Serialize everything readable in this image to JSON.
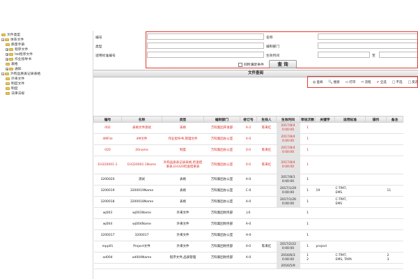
{
  "tree": {
    "root": "文件类型",
    "items": [
      {
        "label": "体系文件",
        "toggle": "−"
      },
      {
        "label": "质量手册",
        "toggle": ""
      },
      {
        "label": "程序文件",
        "toggle": "+"
      },
      {
        "label": "iso程序文件",
        "toggle": "+"
      },
      {
        "label": "作业指导书",
        "toggle": "+"
      },
      {
        "label": "表格",
        "toggle": ""
      },
      {
        "label": "通知",
        "toggle": "+"
      },
      {
        "label": "外购品质表记录表格",
        "toggle": "−"
      },
      {
        "label": "外来文件",
        "toggle": ""
      },
      {
        "label": "制度文件",
        "toggle": ""
      },
      {
        "label": "制度",
        "toggle": ""
      },
      {
        "label": "法律法规",
        "toggle": ""
      }
    ]
  },
  "query": {
    "labels": {
      "number": "编号",
      "name": "名称",
      "type": "类型",
      "dept": "编制部门",
      "standard_no": "适用标准编号",
      "effective_time": "生效时间",
      "to": "至"
    },
    "condition_label": "同时满足条件",
    "query_button": "查 询"
  },
  "section_title": "文件查阅",
  "toolbar": [
    {
      "icon": "view-icon",
      "glyph": "◎",
      "label": "查阅"
    },
    {
      "icon": "search-icon",
      "glyph": "🔍",
      "label": "搜索"
    },
    {
      "icon": "print-icon",
      "glyph": "▭",
      "label": "打印"
    },
    {
      "icon": "flow-icon",
      "glyph": "⇨",
      "label": "流程"
    },
    {
      "icon": "check-all-icon",
      "glyph": "✔",
      "label": "全选"
    },
    {
      "icon": "deselect-icon",
      "glyph": "▢",
      "label": "不选"
    },
    {
      "icon": "invert-icon",
      "glyph": "▢",
      "label": "反选"
    }
  ],
  "table": {
    "columns": [
      "编号",
      "名称",
      "类型",
      "编制部门",
      "修订号",
      "生效人",
      "生效时间",
      "审核次数",
      "关键字",
      "适用标准",
      "操作",
      "备注"
    ],
    "rows": [
      {
        "red": true,
        "cells": [
          "002",
          "表格文件测试",
          "表格",
          "万科集团开发部",
          "A-2",
          "陈来红",
          "2017/8/4\n0:00:00",
          "1",
          "",
          "",
          "",
          ""
        ]
      },
      {
        "red": true,
        "cells": [
          "4MFile",
          "4M文件",
          "作业指导书,管理文件",
          "万科集团办公室",
          "A-0",
          "",
          "2017/8/4\n0:00:00",
          "1",
          "",
          "",
          "",
          ""
        ]
      },
      {
        "red": true,
        "cells": [
          "020",
          "20name",
          "制度",
          "万科集团办公室",
          "0-0",
          "陈来红",
          "2017/8/4\n0:00:00",
          "1",
          "",
          "",
          "",
          ""
        ]
      },
      {
        "red": true,
        "cells": [
          "EH320001-1",
          "EH320001-1Name",
          "外购品质表记录表格,检查结果表,EH320检查结果表",
          "万科集团办公室",
          "0-0",
          "陈来红",
          "2017/8/4\n0:00:00",
          "1",
          "",
          "",
          "",
          ""
        ]
      },
      {
        "red": false,
        "cells": [
          "3200020",
          "测试",
          "表格",
          "万科集团办公室",
          "A-0",
          "",
          "2017/8/1\n0:00:00",
          "1",
          "",
          "",
          "",
          ""
        ]
      },
      {
        "red": false,
        "cells": [
          "3200019",
          "3200019Name",
          "表格",
          "万科集团办公室",
          "C-0",
          "",
          "2017/1/29\n0:00:00",
          "1",
          "19",
          "C-TPAT,\nEMS",
          "",
          "11"
        ]
      },
      {
        "red": false,
        "cells": [
          "3200018",
          "3200018Name",
          "表格",
          "万科集团办公室",
          "A-0",
          "",
          "2017/1/26\n0:00:00",
          "1",
          "",
          "C-TPAT,\nEMS",
          "",
          ""
        ]
      },
      {
        "red": false,
        "cells": [
          "wj003",
          "wj003Name",
          "外来文件",
          "万科集团财务部",
          "J-0",
          "",
          "",
          "1",
          "",
          "",
          "",
          ""
        ]
      },
      {
        "red": false,
        "cells": [
          "wj004",
          "wj004Name",
          "外来文件",
          "万科集团财务部",
          "A-0",
          "",
          "",
          "1",
          "",
          "",
          "",
          ""
        ]
      },
      {
        "red": false,
        "cells": [
          "3200017",
          "3200017",
          "外来文件",
          "万科集团办公室",
          "H-0",
          "",
          "",
          "1",
          "",
          "",
          "",
          ""
        ]
      },
      {
        "red": false,
        "cells": [
          "mpp01",
          "Project文件",
          "外来文件",
          "万科集团财务部",
          "0-0",
          "陈来红",
          "2017/2/22\n0:00:00",
          "1",
          "project",
          "",
          "",
          ""
        ]
      },
      {
        "red": false,
        "cells": [
          "ad004",
          "ad004Name",
          "程序文件,品质管理",
          "万科集团财务部",
          "A-0",
          "",
          "2016/6/3\n0:00:00",
          "1\n2",
          "",
          "C-TPAT,\nEMS, TAPA",
          "",
          "2\n3"
        ]
      },
      {
        "red": false,
        "cells": [
          "",
          "",
          "",
          "",
          "",
          "",
          "2016/5/9",
          "",
          "",
          "",
          "",
          ""
        ]
      }
    ]
  },
  "colors": {
    "highlight": "#e3372c",
    "red_text": "#d62b24",
    "folder": "#e8c65c"
  }
}
